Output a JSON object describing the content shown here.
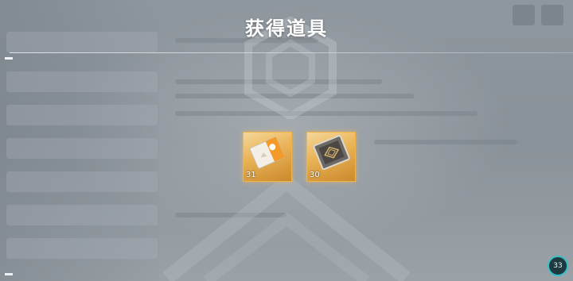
{
  "popup": {
    "title": "获得道具"
  },
  "items": [
    {
      "name": "orange-ticket",
      "count": "31",
      "rarity_color": "#f2b24a"
    },
    {
      "name": "silver-card",
      "count": "30",
      "rarity_color": "#f2b24a"
    }
  ],
  "hud": {
    "gauge_value": "33"
  },
  "colors": {
    "accent_gold": "#f2b24a",
    "gauge_ring": "#35c0c8"
  }
}
